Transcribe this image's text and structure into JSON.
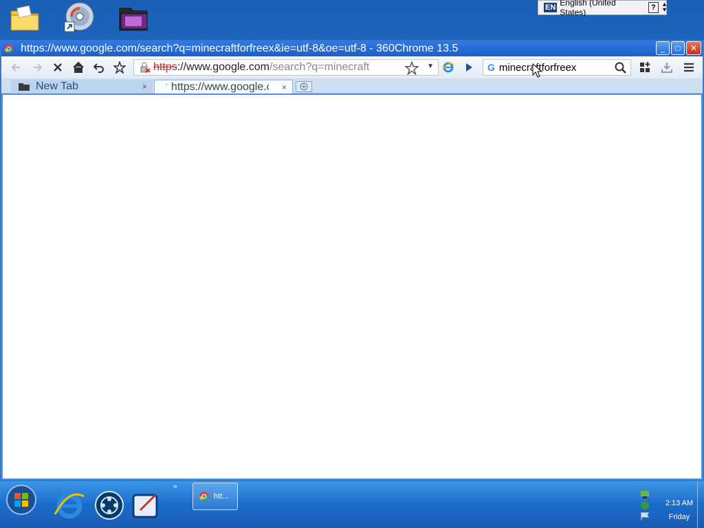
{
  "desktop": {
    "icons": [
      "folder-icon",
      "disc-shortcut-icon",
      "movie-folder-icon"
    ]
  },
  "language_bar": {
    "badge": "EN",
    "label": "English (United States)",
    "help": "?"
  },
  "window": {
    "title": "https://www.google.com/search?q=minecraftforfreex&ie=utf-8&oe=utf-8 - 360Chrome 13.5",
    "controls": {
      "minimize": "_",
      "maximize": "□",
      "close": "✕"
    }
  },
  "toolbar": {
    "address": {
      "scheme": "https",
      "host": "://www.google.com",
      "path": "/search?q=minecraft"
    },
    "search": {
      "engine": "G",
      "value": "minecraftforfreex"
    }
  },
  "tabs": [
    {
      "label": "New Tab",
      "close": "×"
    },
    {
      "label": "https://www.google.com/search?q=minecraftforfreex",
      "close": "×"
    }
  ],
  "taskbar": {
    "task_label": "htt...",
    "more": "»",
    "clock_time": "2:13 AM",
    "clock_day": "Friday"
  },
  "colors": {
    "accent": "#1c5fc7",
    "desktop": "#1e6fd0",
    "insecure": "#c62828"
  }
}
